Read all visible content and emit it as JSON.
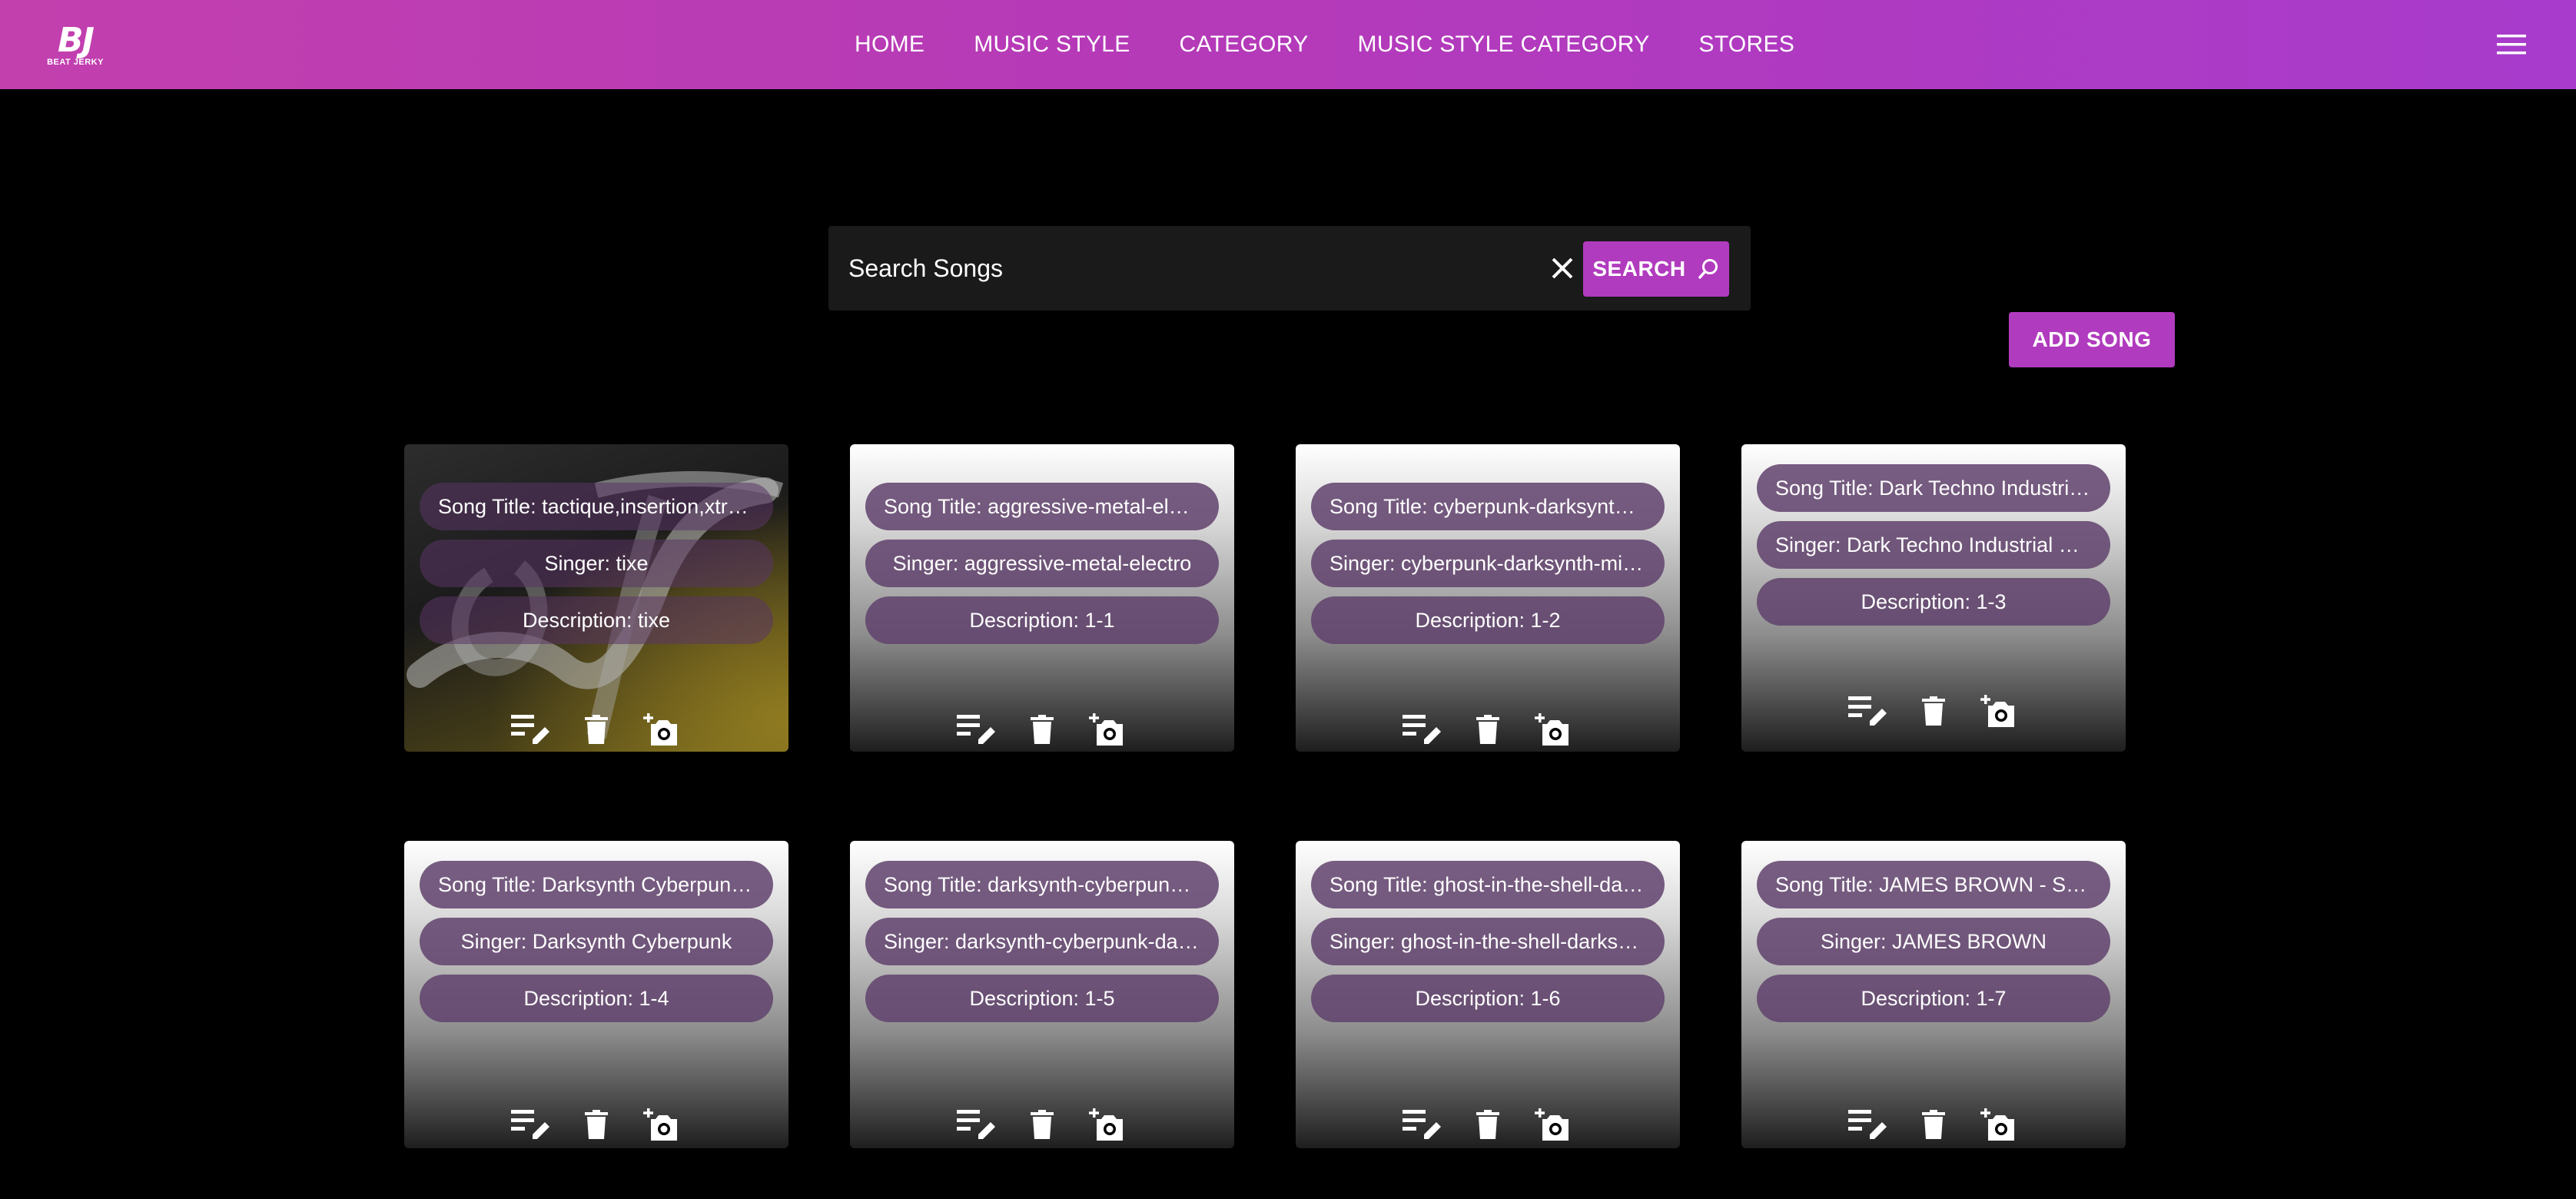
{
  "brand": {
    "logo_mark": "BJ",
    "logo_text": "BEAT JERKY"
  },
  "nav": {
    "items": [
      "HOME",
      "MUSIC STYLE",
      "CATEGORY",
      "MUSIC STYLE CATEGORY",
      "STORES"
    ]
  },
  "icons": {
    "menu": "hamburger-menu-icon",
    "clear": "close-icon",
    "search": "search-icon",
    "edit": "edit-list-icon",
    "delete": "trash-icon",
    "photo": "add-photo-icon"
  },
  "colors": {
    "accent": "#b13bbe",
    "header_start": "#c23fae",
    "header_end": "#a83bcc",
    "pill": "#60426c",
    "background": "#000000"
  },
  "search": {
    "placeholder": "Search Songs",
    "button_label": "SEARCH"
  },
  "add_song_label": "ADD SONG",
  "songs": [
    {
      "title": "Song Title: tactique,insertion,xtra...",
      "singer": "Singer: tixe",
      "description": "Description: tixe"
    },
    {
      "title": "Song Title: aggressive-metal-elec...",
      "singer": "Singer: aggressive-metal-electro",
      "description": "Description: 1-1"
    },
    {
      "title": "Song Title: cyberpunk-darksynth-...",
      "singer": "Singer: cyberpunk-darksynth-midt...",
      "description": "Description: 1-2"
    },
    {
      "title": "Song Title: Dark Techno Industrial...",
      "singer": "Singer: Dark Techno Industrial Cy...",
      "description": "Description: 1-3"
    },
    {
      "title": "Song Title: Darksynth Cyberpunk ...",
      "singer": "Singer: Darksynth Cyberpunk",
      "description": "Description: 1-4"
    },
    {
      "title": "Song Title: darksynth-cyberpunk-...",
      "singer": "Singer: darksynth-cyberpunk-dar...",
      "description": "Description: 1-5"
    },
    {
      "title": "Song Title: ghost-in-the-shell-dark...",
      "singer": "Singer: ghost-in-the-shell-darksyn...",
      "description": "Description: 1-6"
    },
    {
      "title": "Song Title: JAMES BROWN - Se...",
      "singer": "Singer: JAMES BROWN",
      "description": "Description: 1-7"
    }
  ]
}
